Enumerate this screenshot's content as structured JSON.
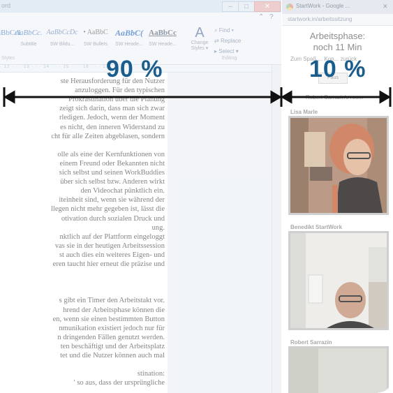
{
  "word": {
    "title_fragment": "ord",
    "window_buttons": {
      "minimize": "–",
      "maximize": "□",
      "close": "✕"
    },
    "ribbon": {
      "chevron": "⌃",
      "help": "?",
      "styles": [
        {
          "sample": "AaBbCcI",
          "label": ""
        },
        {
          "sample": "AaBbCc.",
          "label": "Subtitle"
        },
        {
          "sample": "AaBbCcDc",
          "label": "SW Bildu..."
        },
        {
          "sample": "• AaBbC",
          "label": "SW Bullets"
        },
        {
          "sample": "AaBbC(",
          "label": "SW Heade..."
        },
        {
          "sample": "AaBbCc",
          "label": "SW Heade..."
        }
      ],
      "change_styles": {
        "label": "Change Styles ▾"
      },
      "editing": {
        "find": "Find ▾",
        "replace": "Replace",
        "select": "Select ▾"
      },
      "group_styles": "Styles",
      "group_editing": "Editing"
    },
    "ruler_marks": "· 12 · · · 13 · · · 14 · · · 15 · · · 16 · · · 17 · · ·",
    "document_lines": [
      "ste Herausforderung für den Nutzer",
      "anzuloggen. Für den typischen",
      "Prokrastination über die Planung",
      "zeigt sich darin, dass man sich zwar",
      "rledigen. Jedoch, wenn der Moment",
      "es nicht, den inneren Widerstand zu",
      "cht für alle Zeiten abgeblasen, sondern",
      "",
      "olle als eine der Kernfunktionen von",
      "einem Freund oder Bekannten nicht",
      "sich selbst und seinen WorkBuddies",
      "über sich selbst bzw. Anderen wirkt",
      "den Videochat pünktlich ein.",
      "iteinheit sind, wenn sie während der",
      "llegen nicht mehr gegeben ist, lässt die",
      "otivation durch sozialen Druck und",
      "ung.",
      "nktlich auf der Plattform eingeloggt",
      "vas sie in der heutigen Arbeitssession",
      "st auch dies ein weiteres Eigen- und",
      "eren taucht hier erneut die präzise und",
      "",
      "",
      "",
      "s gibt ein Timer den Arbeitstakt vor.",
      "hrend der Arbeitsphase können die",
      "en, wenn sie einen bestimmten Button",
      "nmunikation existiert jedoch nur für",
      "n dringenden Fällen genutzt werden.",
      "ten beschäftigt und der Arbeitsplatz",
      "tet und die Nutzer können auch mal",
      "",
      "stination:",
      "' so aus, dass der ursprüngliche"
    ]
  },
  "chrome": {
    "tab_title": "StartWork - Google ...",
    "close": "✕",
    "url": "startwork.in/arbeitssitzung",
    "phase_title": "Arbeitsphase:",
    "timer": "noch 11 Min",
    "back_text": "Zum Spaß ... Kon... zurück",
    "pause_label": "Paus",
    "room_name": "Robert Sarrazin's room",
    "participants": [
      {
        "name": "Lisa Marle"
      },
      {
        "name": "Benedikt StartWork"
      },
      {
        "name": "Robert Sarrazin"
      }
    ]
  },
  "annotation": {
    "word_share": "90 %",
    "chrome_share": "10 %",
    "color": "#1a5d8c"
  }
}
